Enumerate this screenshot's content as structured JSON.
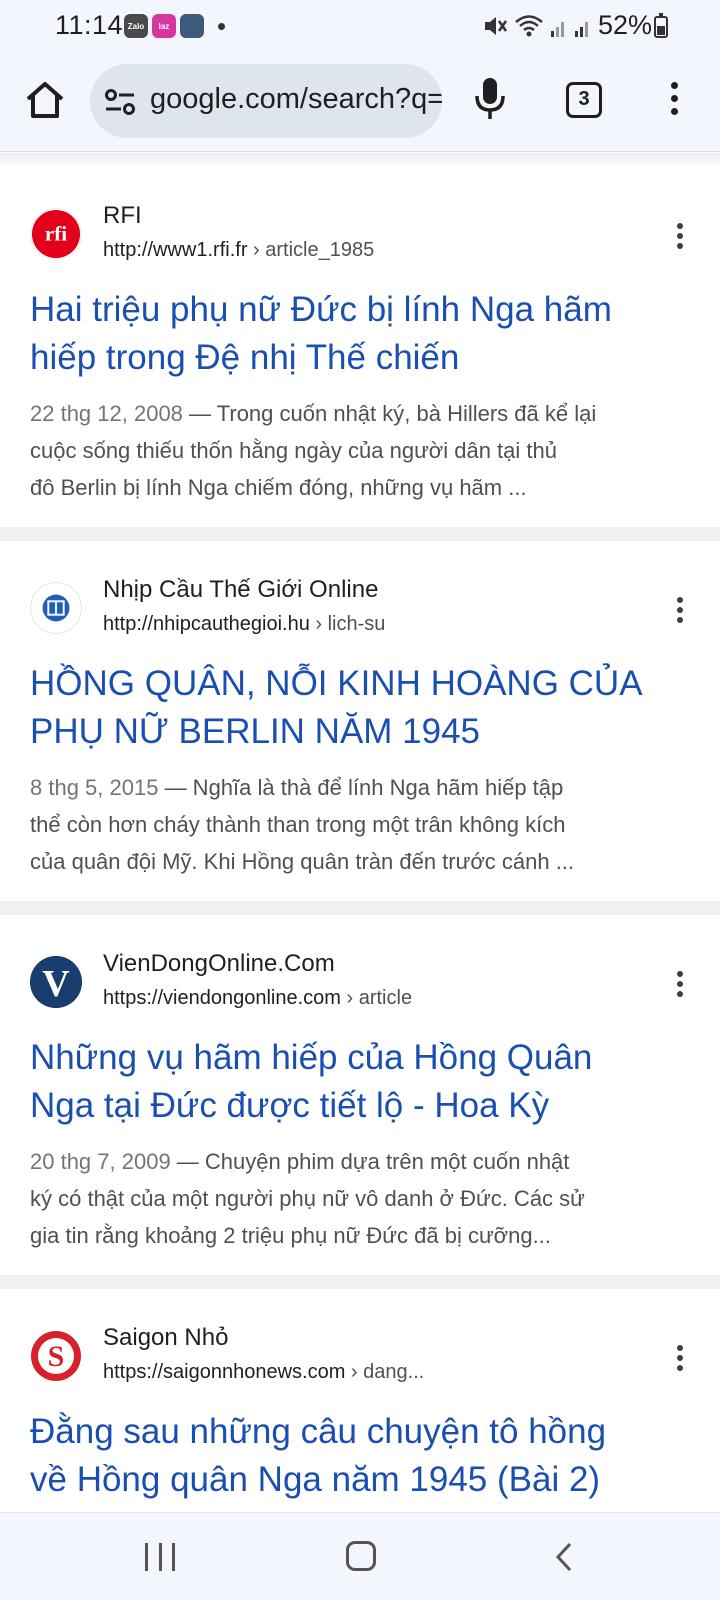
{
  "status_bar": {
    "time": "11:14",
    "notification_apps": [
      "Zalo",
      "laz",
      "game"
    ],
    "battery_pct": "52%"
  },
  "toolbar": {
    "url": "google.com/search?q=",
    "tab_count": "3"
  },
  "results": [
    {
      "site_name": "RFI",
      "url_domain": "http://www1.rfi.fr",
      "url_path": " › article_1985",
      "favicon": "rfi-logo-icon",
      "favicon_color": "#e2001a",
      "favicon_text": "rfi",
      "title_line1": "Hai triệu phụ nữ Đức bị lính Nga hãm",
      "title_line2": "hiếp trong Đệ nhị Thế chiến",
      "date": "22 thg 12, 2008",
      "snippet_line1_rest": " — Trong cuốn nhật ký, bà Hillers đã kể lại",
      "snippet_line2": "cuộc sống thiếu thốn hằng ngày của người dân tại thủ",
      "snippet_line3": "đô Berlin bị lính Nga chiếm đóng, những vụ hãm ..."
    },
    {
      "site_name": "Nhịp Cầu Thế Giới Online",
      "url_domain": "http://nhipcauthegioi.hu",
      "url_path": " › lich-su",
      "favicon": "nhipcau-logo-icon",
      "favicon_color": "#1f5fb8",
      "title_line1": "HỒNG QUÂN, NỖI KINH HOÀNG CỦA",
      "title_line2": "PHỤ NỮ BERLIN NĂM 1945",
      "date": "8 thg 5, 2015",
      "snippet_line1_rest": " — Nghĩa là thà để lính Nga hãm hiếp tập",
      "snippet_line2": "thể còn hơn cháy thành than trong một trân không kích",
      "snippet_line3": "của quân đội Mỹ. Khi Hồng quân tràn đến trước cánh ..."
    },
    {
      "site_name": "VienDongOnline.Com",
      "url_domain": "https://viendongonline.com",
      "url_path": " › article",
      "favicon": "viendong-logo-icon",
      "favicon_color": "#173e6e",
      "favicon_text": "V",
      "title_line1": "Những vụ hãm hiếp của Hồng Quân",
      "title_line2": "Nga tại Đức được tiết lộ - Hoa Kỳ",
      "date": "20 thg 7, 2009",
      "snippet_line1_rest": " — Chuyện phim dựa trên một cuốn nhật",
      "snippet_line2": "ký có thật của một người phụ nữ vô danh ở Đức. Các sử",
      "snippet_line3": "gia tin rằng khoảng 2 triệu phụ nữ Đức đã bị cưỡng..."
    },
    {
      "site_name": "Saigon Nhỏ",
      "url_domain": "https://saigonnhonews.com",
      "url_path": " › dang...",
      "favicon": "saigonnho-logo-icon",
      "favicon_color": "#d6202a",
      "favicon_text": "S",
      "title_line1": "Đằng sau những câu chuyện tô hồng",
      "title_line2": "về Hồng quân Nga năm 1945 (Bài 2)"
    }
  ]
}
